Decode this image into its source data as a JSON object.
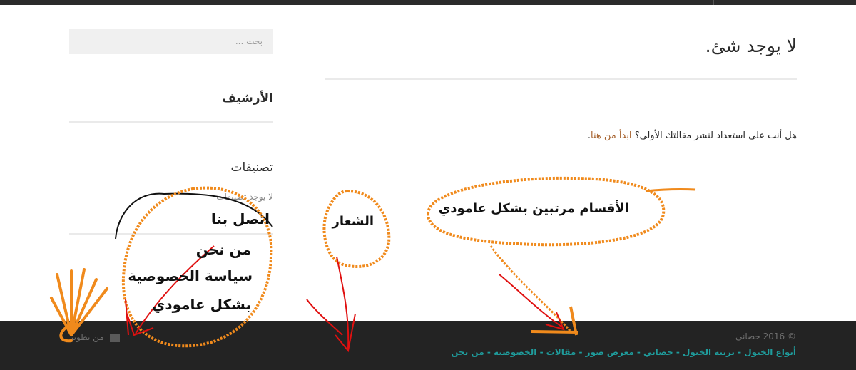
{
  "main": {
    "title": "لا يوجد شئ.",
    "intro_text": "هل أنت على استعداد لنشر مقالتك الأولى؟",
    "intro_link": "ابدأ من هنا",
    "intro_end": "."
  },
  "sidebar": {
    "search_placeholder": "بحث ...",
    "archive_title": "الأرشيف",
    "categories_title": "تصنيفات",
    "no_categories": "لا يوجد تصنيفات"
  },
  "footer": {
    "copyright": "© 2016 حصاني",
    "nav_items": [
      "أنواع الخيول",
      "تربية الخيول",
      "حصاني",
      "معرض صور",
      "مقالات",
      "الخصوصية",
      "من نحن"
    ],
    "nav_separator": " - ",
    "credit": "من تطوير"
  },
  "annotations": {
    "contact_lines": [
      "اتصل بنا",
      "من نحن",
      "سياسة الخصوصية",
      "بشكل عامودي"
    ],
    "logo_note": "الشعار",
    "sections_note": "الأقسام مرتبين بشكل عامودي"
  },
  "colors": {
    "link": "#a7632f",
    "footer_link": "#1f9c9c",
    "annotation_orange": "#f08a1c",
    "annotation_red": "#e01010"
  }
}
